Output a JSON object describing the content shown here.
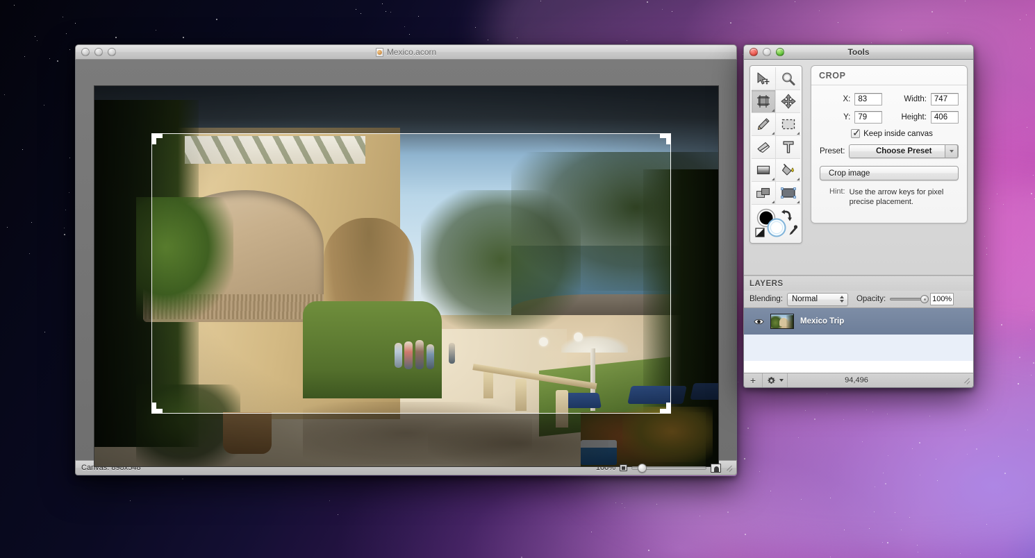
{
  "app": {
    "name": "Acorn"
  },
  "document_window": {
    "title": "Mexico.acorn",
    "title_icon": "acorn-document-icon",
    "traffic_lights": [
      "close-button",
      "minimize-button",
      "zoom-button"
    ],
    "status": {
      "canvas_label": "Canvas: 898x548",
      "zoom_percent": "100%",
      "fit_icon": "fit-image-icon",
      "actual_size_icon": "actual-size-icon",
      "resize_grip_icon": "resize-grip-icon"
    }
  },
  "tools_window": {
    "title": "Tools",
    "traffic_lights": [
      "close-button",
      "minimize-button",
      "zoom-button"
    ],
    "tool_palette": {
      "tools": [
        {
          "name": "move-tool",
          "icon": "arrow-move-icon",
          "selected": false
        },
        {
          "name": "zoom-tool",
          "icon": "magnifier-icon",
          "selected": false
        },
        {
          "name": "crop-tool",
          "icon": "crop-icon",
          "selected": true
        },
        {
          "name": "pan-tool",
          "icon": "four-way-arrow-icon",
          "selected": false
        },
        {
          "name": "pencil-tool",
          "icon": "pencil-icon",
          "selected": false
        },
        {
          "name": "rectangular-selection-tool",
          "icon": "marquee-icon",
          "selected": false
        },
        {
          "name": "eraser-tool",
          "icon": "eraser-icon",
          "selected": false
        },
        {
          "name": "text-tool",
          "icon": "text-t-icon",
          "selected": false
        },
        {
          "name": "gradient-tool",
          "icon": "gradient-icon",
          "selected": false
        },
        {
          "name": "paint-bucket-tool",
          "icon": "paint-bucket-icon",
          "selected": false
        },
        {
          "name": "shape-tool",
          "icon": "shapes-icon",
          "selected": false
        },
        {
          "name": "bezier-shape-tool",
          "icon": "rounded-rect-icon",
          "selected": true
        }
      ],
      "color_well": {
        "icon": "foreground-background-color-well",
        "foreground": "#000000",
        "background": "#ffffff",
        "swap_icon": "swap-colors-icon",
        "reset_icon": "reset-colors-icon",
        "eyedropper_icon": "eyedropper-icon"
      }
    },
    "crop_panel": {
      "heading": "CROP",
      "x_label": "X:",
      "x_value": "83",
      "y_label": "Y:",
      "y_value": "79",
      "width_label": "Width:",
      "width_value": "747",
      "height_label": "Height:",
      "height_value": "406",
      "keep_inside_label": "Keep inside canvas",
      "keep_inside_checked": true,
      "preset_label": "Preset:",
      "preset_value": "Choose Preset",
      "crop_button": "Crop image",
      "hint_label": "Hint:",
      "hint_text": "Use the arrow keys for pixel precise placement."
    },
    "layers_panel": {
      "heading": "LAYERS",
      "blending_label": "Blending:",
      "blending_value": "Normal",
      "opacity_label": "Opacity:",
      "opacity_value": "100%",
      "layers": [
        {
          "name": "Mexico Trip",
          "visible": true,
          "visibility_icon": "eye-icon",
          "thumbnail_icon": "layer-thumbnail"
        }
      ],
      "footer": {
        "add_layer_icon": "plus-icon",
        "actions_icon": "gear-icon",
        "actions_disclosure_icon": "chevron-down-icon",
        "byte_count": "94,496",
        "resize_grip_icon": "resize-grip-icon"
      }
    }
  },
  "canvas": {
    "image_name": "mexico-resort-photograph",
    "crop_selection": {
      "handle_icon": "crop-handle",
      "handles": [
        "top-left",
        "top-right",
        "bottom-left",
        "bottom-right"
      ]
    }
  },
  "colors": {
    "selection_blue": "#6d7e99",
    "crop_outline": "#ffffff",
    "panel_gray": "#d4d4d4",
    "heading_gray": "#5f5f5f"
  }
}
